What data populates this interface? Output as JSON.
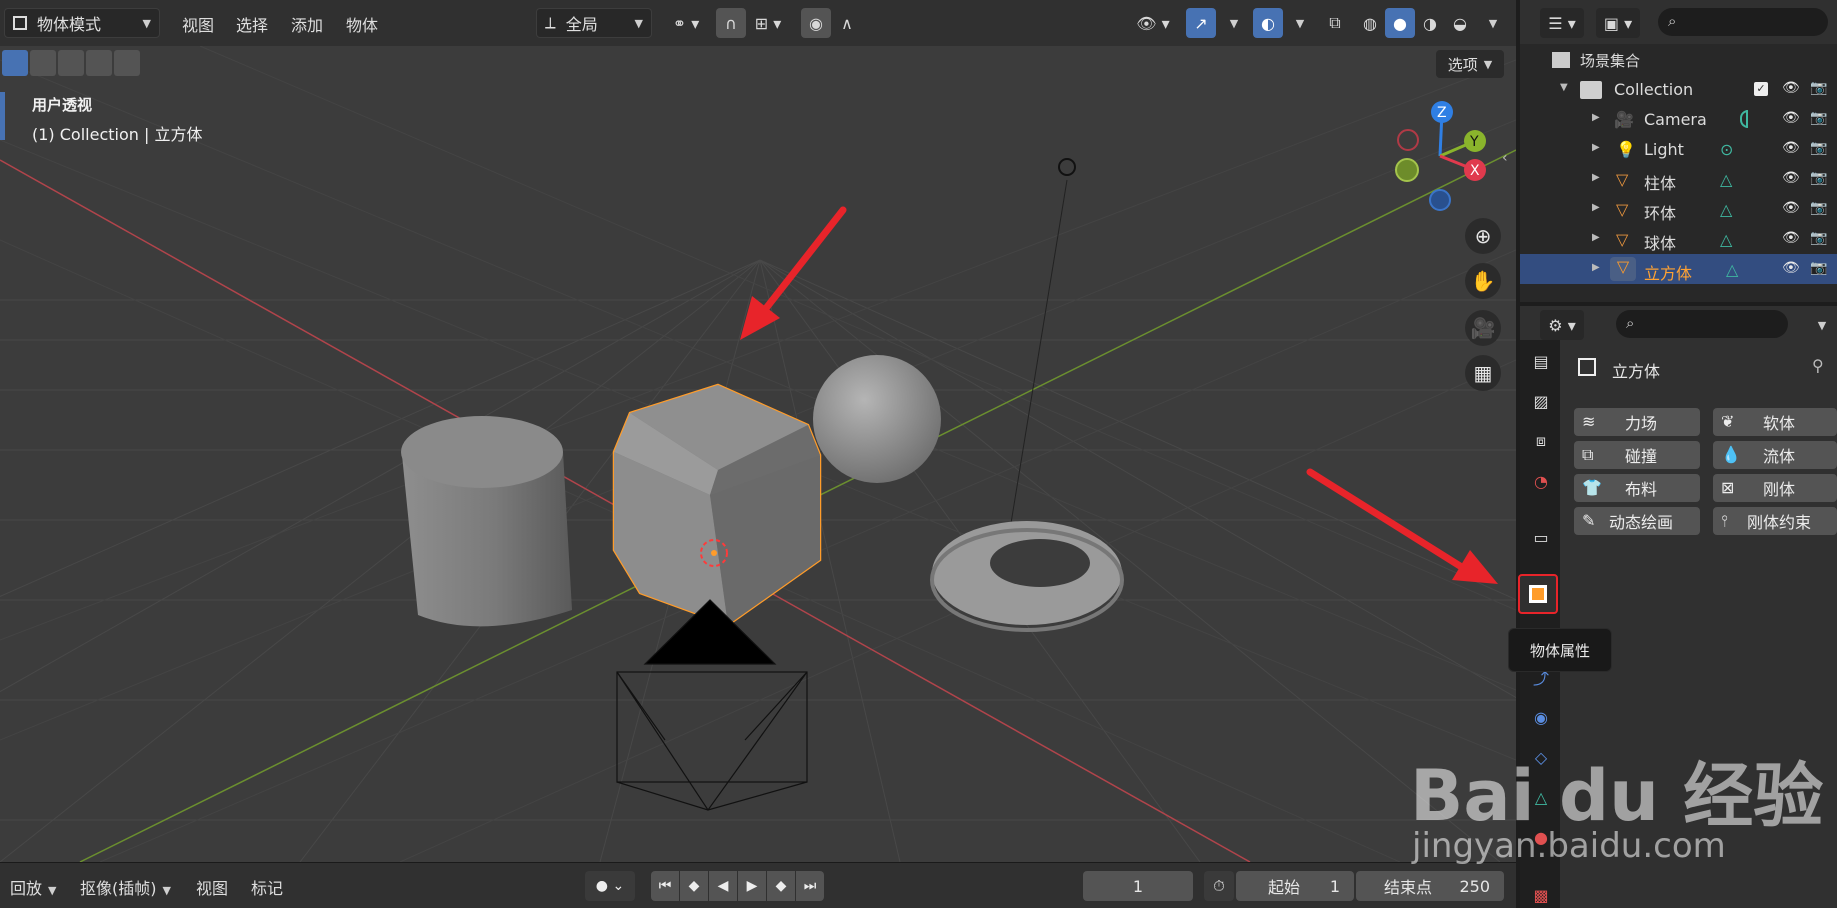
{
  "header": {
    "mode": "物体模式",
    "menus": [
      "视图",
      "选择",
      "添加",
      "物体"
    ],
    "transform_orientation": "全局",
    "options": "选项"
  },
  "viewport": {
    "title": "用户透视",
    "subtitle": "(1) Collection | 立方体",
    "gizmo_axes": {
      "z": "Z",
      "y": "Y",
      "x": "X"
    }
  },
  "timeline": {
    "playback": "回放",
    "keying": "抠像(插帧)",
    "view": "视图",
    "marker": "标记",
    "current_frame": "1",
    "start_label": "起始",
    "start_value": "1",
    "end_label": "结束点",
    "end_value": "250"
  },
  "outliner": {
    "scene_collection": "场景集合",
    "collection": "Collection",
    "items": [
      {
        "label": "Camera",
        "type": "camera"
      },
      {
        "label": "Light",
        "type": "light"
      },
      {
        "label": "柱体",
        "type": "mesh"
      },
      {
        "label": "环体",
        "type": "mesh"
      },
      {
        "label": "球体",
        "type": "mesh"
      },
      {
        "label": "立方体",
        "type": "mesh",
        "selected": true
      }
    ]
  },
  "properties": {
    "object_name": "立方体",
    "physics_buttons": [
      {
        "label": "力场",
        "icon": "force-field-icon"
      },
      {
        "label": "软体",
        "icon": "soft-body-icon"
      },
      {
        "label": "碰撞",
        "icon": "collision-icon"
      },
      {
        "label": "流体",
        "icon": "fluid-icon"
      },
      {
        "label": "布料",
        "icon": "cloth-icon"
      },
      {
        "label": "刚体",
        "icon": "rigid-body-icon"
      },
      {
        "label": "动态绘画",
        "icon": "dynamic-paint-icon"
      },
      {
        "label": "刚体约束",
        "icon": "rigid-body-constraint-icon"
      }
    ],
    "tooltip": "物体属性"
  },
  "watermark": {
    "brand": "Bai du 经验",
    "url": "jingyan.baidu.com"
  },
  "colors": {
    "accent": "#4772b3",
    "selection": "#ff9c2a",
    "annotation_red": "#e8242a"
  }
}
